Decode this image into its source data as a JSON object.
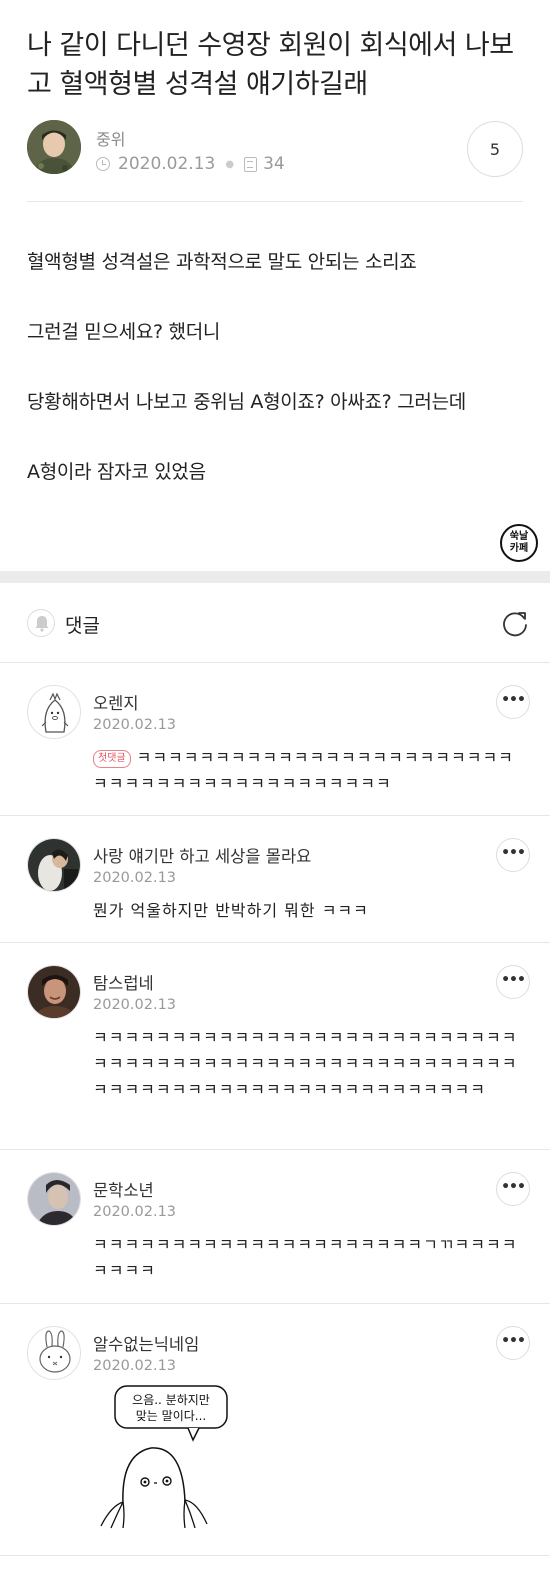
{
  "post": {
    "title": "나 같이 다니던 수영장 회원이 회식에서 나보고 혈액형별 성격설 얘기하길래",
    "author": "중위",
    "date": "2020.02.13",
    "views": "34",
    "comment_count": "5",
    "body": [
      "혈액형별 성격설은 과학적으로 말도 안되는 소리죠",
      "그런걸 믿으세요? 했더니",
      "당황해하면서 나보고 중위님 A형이죠? 아싸죠? 그러는데",
      "A형이라 잠자코 있었음"
    ],
    "stamp": [
      "쑥날",
      "카페"
    ]
  },
  "comments_section": {
    "label": "댓글",
    "items": [
      {
        "name": "오렌지",
        "date": "2020.02.13",
        "badge": "첫댓글",
        "text": "ㅋㅋㅋㅋㅋㅋㅋㅋㅋㅋㅋㅋㅋㅋㅋㅋㅋㅋㅋㅋㅋㅋㅋㅋㅋㅋㅋㅋㅋㅋㅋㅋㅋㅋㅋㅋㅋㅋㅋㅋㅋㅋㅋ"
      },
      {
        "name": "사랑 얘기만 하고 세상을 몰라요",
        "date": "2020.02.13",
        "text": "뭔가 억울하지만 반박하기 뭐한 ㅋㅋㅋ"
      },
      {
        "name": "탐스럽네",
        "date": "2020.02.13",
        "text": "ㅋㅋㅋㅋㅋㅋㅋㅋㅋㅋㅋㅋㅋㅋㅋㅋㅋㅋㅋㅋㅋㅋㅋㅋㅋㅋㅋㅋㅋㅋㅋㅋㅋㅋㅋㅋㅋㅋㅋㅋㅋㅋㅋㅋㅋㅋㅋㅋㅋㅋㅋㅋㅋㅋㅋㅋㅋㅋㅋㅋㅋㅋㅋㅋㅋㅋㅋㅋㅋㅋㅋㅋㅋㅋㅋㅋㅋㅋㅋ"
      },
      {
        "name": "문학소년",
        "date": "2020.02.13",
        "text": "ㅋㅋㅋㅋㅋㅋㅋㅋㅋㅋㅋㅋㅋㅋㅋㅋㅋㅋㅋㅋㅋㄱㄲㅋㅋㅋㅋㅋㅋㅋㅋ"
      },
      {
        "name": "알수없는닉네임",
        "date": "2020.02.13",
        "sticker_text": [
          "으음.. 분하지만",
          "맞는 말이다..."
        ]
      }
    ]
  },
  "colors": {
    "divider": "#e6e6e6",
    "section_gap": "#ebebeb",
    "badge": "#e05561"
  },
  "icons": [
    "clock-icon",
    "document-icon",
    "bell-icon",
    "refresh-icon",
    "more-icon"
  ]
}
